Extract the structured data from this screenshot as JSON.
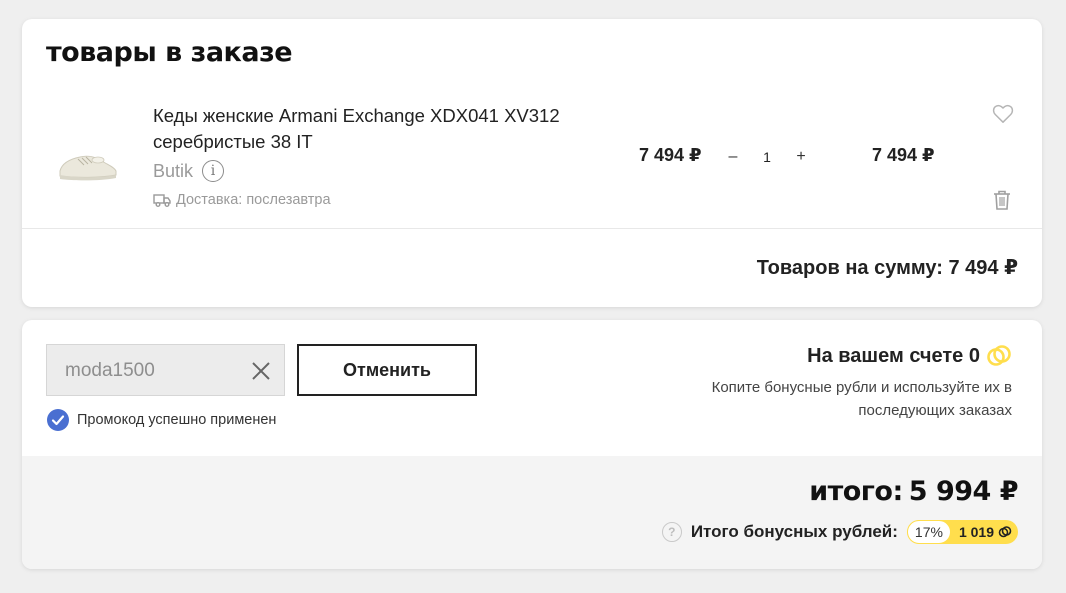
{
  "order": {
    "title": "товары в заказе",
    "item": {
      "name": "Кеды женские Armani Exchange XDX041 XV312 серебристые 38 IT",
      "seller": "Butik",
      "delivery": "Доставка: послезавтра",
      "unit_price": "7 494 ₽",
      "quantity": "1",
      "total_price": "7 494 ₽",
      "minus_label": "–",
      "plus_label": "+"
    },
    "sum_label": "Товаров на сумму: 7 494 ₽"
  },
  "promo": {
    "code": "moda1500",
    "cancel_label": "Отменить",
    "status": "Промокод успешно применен"
  },
  "account": {
    "balance_label": "На вашем счете 0",
    "note": "Копите бонусные рубли и используйте их в последующих заказах"
  },
  "totals": {
    "label": "итого:",
    "value": "5 994 ₽",
    "bonus_label": "Итого бонусных рублей:",
    "bonus_percent": "17%",
    "bonus_value": "1 019"
  },
  "colors": {
    "accent_blue": "#4a6fd1",
    "bonus_yellow": "#ffde4d"
  },
  "icons": [
    "info-icon",
    "truck-icon",
    "heart-icon",
    "trash-icon",
    "close-icon",
    "check-icon",
    "coin-icon",
    "question-icon"
  ]
}
